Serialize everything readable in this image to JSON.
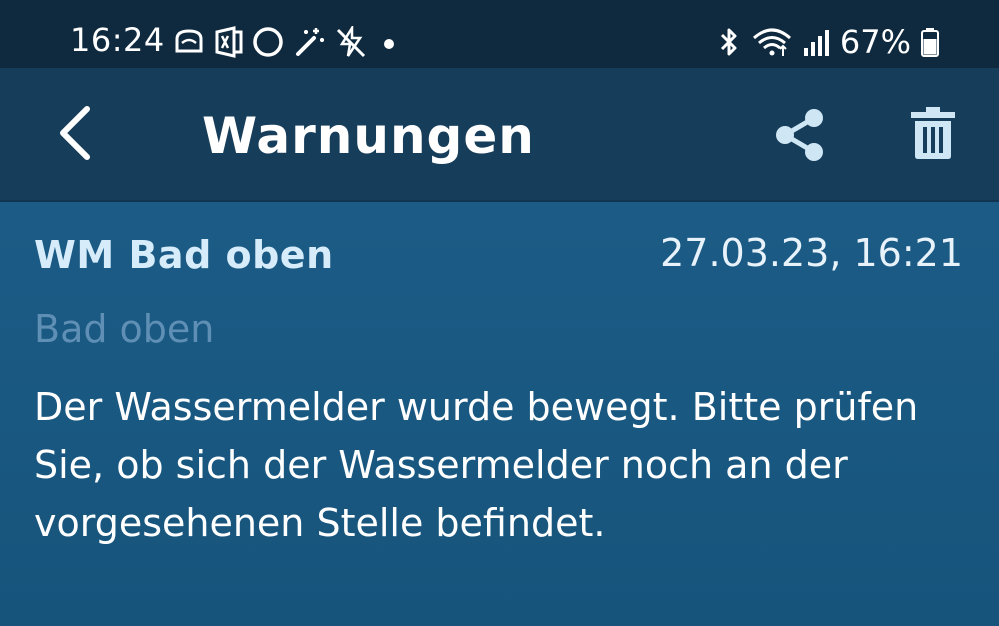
{
  "status_bar": {
    "time": "16:24",
    "battery": "67%",
    "icons_left": [
      "face-id-icon",
      "office-icon",
      "circle-icon",
      "magic-wand-icon",
      "flash-off-icon",
      "dot-icon"
    ],
    "icons_right": [
      "bluetooth-icon",
      "wifi-icon",
      "signal-icon",
      "battery-icon"
    ]
  },
  "toolbar": {
    "title": "Warnungen",
    "back_icon": "chevron-left-icon",
    "share_icon": "share-icon",
    "delete_icon": "trash-icon"
  },
  "warning": {
    "device": "WM Bad oben",
    "timestamp": "27.03.23, 16:21",
    "room": "Bad oben",
    "message": "Der Wassermelder wurde bewegt. Bitte prüfen Sie, ob sich der Wassermelder noch an der vorgesehenen Stelle befindet."
  },
  "colors": {
    "status_bar_bg": "#0f2a3f",
    "toolbar_bg": "#163d5a",
    "content_bg": "#1d5f8a",
    "device_text": "#d6ecfa",
    "room_text": "#5f8fb4"
  }
}
